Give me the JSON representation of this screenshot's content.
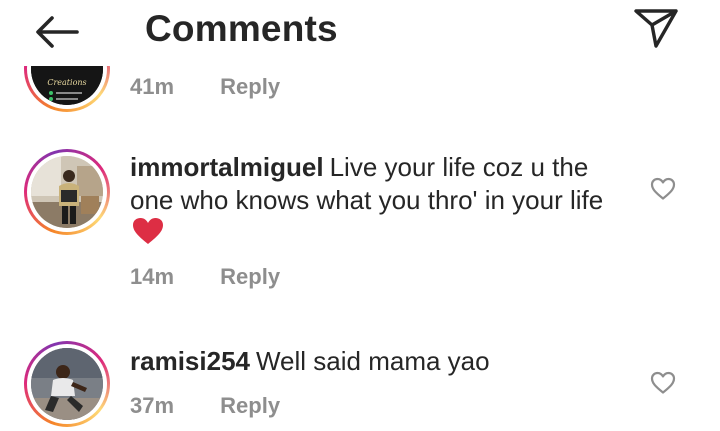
{
  "header": {
    "title": "Comments",
    "back_icon": "arrow-left-icon",
    "direct_icon": "paper-plane-icon"
  },
  "comments": [
    {
      "username": "",
      "text": "",
      "time": "41m",
      "reply_label": "Reply"
    },
    {
      "username": "immortalmiguel",
      "text": "Live your life coz u the one who knows what you thro' in your life",
      "emoji": "red-heart",
      "time": "14m",
      "reply_label": "Reply"
    },
    {
      "username": "ramisi254",
      "text": "Well said mama yao",
      "time": "37m",
      "reply_label": "Reply"
    }
  ],
  "colors": {
    "text": "#262626",
    "meta": "#8e8e8e",
    "story_ring_start": "#f58529",
    "story_ring_end": "#dd2a7b",
    "heart": "#e0245e"
  }
}
